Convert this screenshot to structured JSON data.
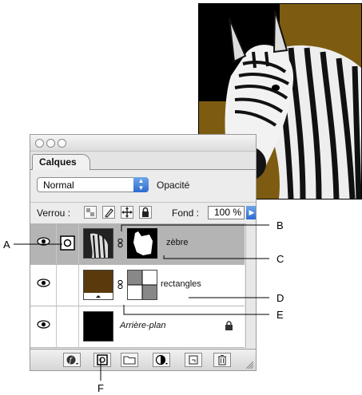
{
  "palette": {
    "tab_label": "Calques",
    "blend_mode": "Normal",
    "opacity_label": "Opacité",
    "lock_label": "Verrou :",
    "fill_label": "Fond :",
    "fill_value": "100 %"
  },
  "layers": [
    {
      "name": "zèbre",
      "selected": true,
      "visible": true
    },
    {
      "name": "rectangles",
      "selected": false,
      "visible": true
    },
    {
      "name": "Arrière-plan",
      "selected": false,
      "visible": true,
      "locked": true
    }
  ],
  "callouts": {
    "a": "A",
    "b": "B",
    "c": "C",
    "d": "D",
    "e": "E",
    "f": "F"
  },
  "colors": {
    "mustard": "#7d5c12",
    "brown": "#5a3a0c",
    "selected_row": "#b4b4b4",
    "accent": "#2c6bd1"
  },
  "icons": [
    "eye-icon",
    "layer-mask-icon",
    "link-icon",
    "lock-icon",
    "trash-icon",
    "new-layer-icon",
    "folder-icon",
    "layer-style-icon",
    "adjustment-layer-icon",
    "add-mask-icon"
  ]
}
